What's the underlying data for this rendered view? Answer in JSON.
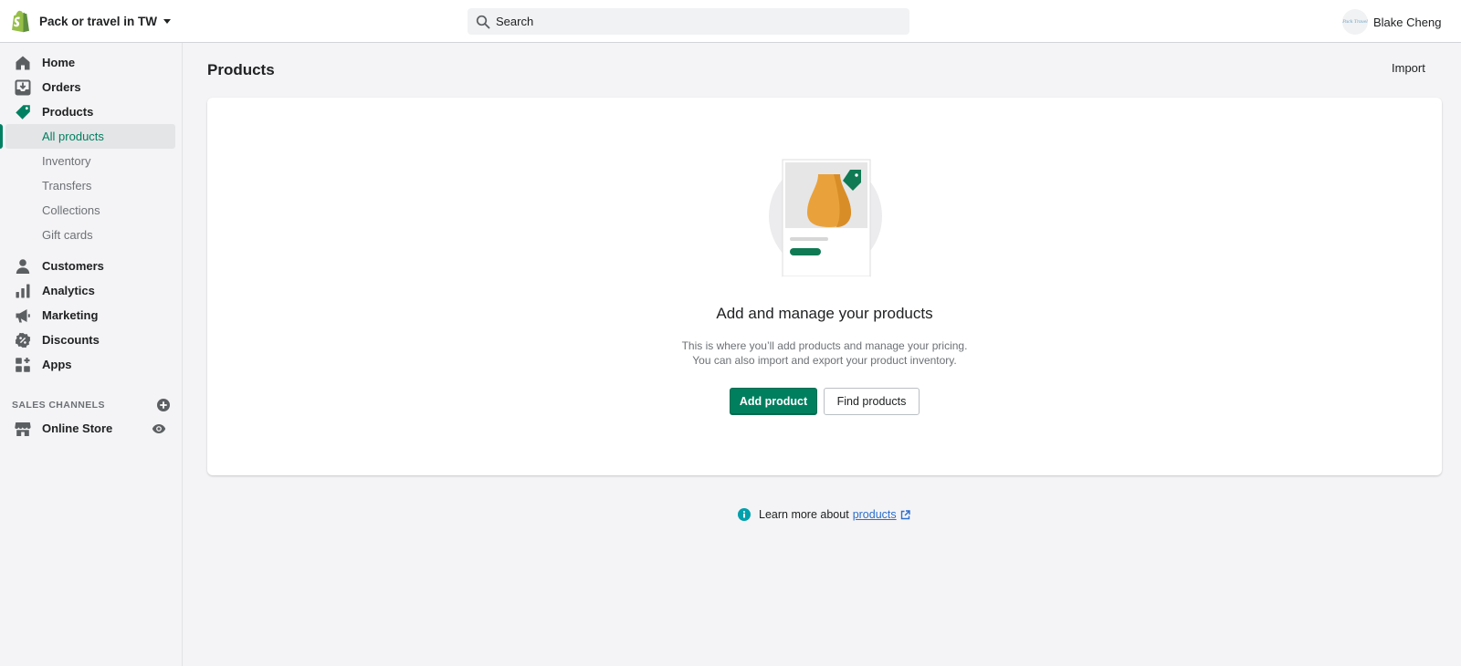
{
  "header": {
    "store_name": "Pack or travel in TW",
    "search_placeholder": "Search",
    "user_name": "Blake Cheng",
    "avatar_text": "Pack Travel"
  },
  "sidebar": {
    "items": [
      {
        "label": "Home",
        "icon": "home-icon"
      },
      {
        "label": "Orders",
        "icon": "orders-icon"
      },
      {
        "label": "Products",
        "icon": "tag-icon"
      }
    ],
    "product_subitems": [
      {
        "label": "All products",
        "active": true
      },
      {
        "label": "Inventory"
      },
      {
        "label": "Transfers"
      },
      {
        "label": "Collections"
      },
      {
        "label": "Gift cards"
      }
    ],
    "items_after": [
      {
        "label": "Customers",
        "icon": "person-icon"
      },
      {
        "label": "Analytics",
        "icon": "bar-chart-icon"
      },
      {
        "label": "Marketing",
        "icon": "megaphone-icon"
      },
      {
        "label": "Discounts",
        "icon": "discount-icon"
      },
      {
        "label": "Apps",
        "icon": "apps-icon"
      }
    ],
    "sales_channels_heading": "SALES CHANNELS",
    "online_store_label": "Online Store"
  },
  "main": {
    "title": "Products",
    "import_label": "Import",
    "empty_state": {
      "title": "Add and manage your products",
      "body_line1": "This is where you’ll add products and manage your pricing.",
      "body_line2": "You can also import and export your product inventory.",
      "primary_label": "Add product",
      "secondary_label": "Find products"
    },
    "learn_more": {
      "text": "Learn more about",
      "link": "products"
    }
  },
  "colors": {
    "brand_green": "#008060",
    "accent_orange": "#e09b3d",
    "link_blue": "#2c6ecb"
  }
}
